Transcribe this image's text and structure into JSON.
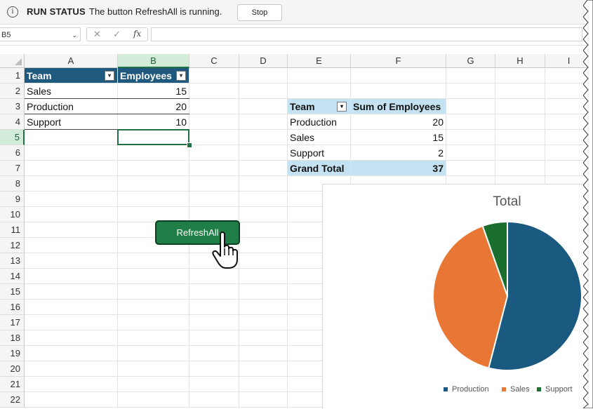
{
  "run_status": {
    "title": "RUN STATUS",
    "message": "The button RefreshAll is running.",
    "stop_label": "Stop",
    "info_glyph": "i"
  },
  "formula_bar": {
    "name_box": "B5",
    "cancel_glyph": "✕",
    "enter_glyph": "✓",
    "fx_glyph": "fx",
    "formula": ""
  },
  "columns": [
    "A",
    "B",
    "C",
    "D",
    "E",
    "F",
    "G",
    "H",
    "I"
  ],
  "selected_column": "B",
  "rows": [
    "1",
    "2",
    "3",
    "4",
    "5",
    "6",
    "7",
    "8",
    "9",
    "10",
    "11",
    "12",
    "13",
    "14",
    "15",
    "16",
    "17",
    "18",
    "19",
    "20",
    "21",
    "22"
  ],
  "selected_row": "5",
  "table": {
    "headers": [
      "Team",
      "Employees"
    ],
    "rows": [
      {
        "team": "Sales",
        "employees": "15"
      },
      {
        "team": "Production",
        "employees": "20"
      },
      {
        "team": "Support",
        "employees": "10"
      }
    ]
  },
  "pivot": {
    "headers": [
      "Team",
      "Sum of Employees"
    ],
    "rows": [
      {
        "team": "Production",
        "sum": "20"
      },
      {
        "team": "Sales",
        "sum": "15"
      },
      {
        "team": "Support",
        "sum": "2"
      }
    ],
    "total_label": "Grand Total",
    "total_value": "37"
  },
  "button": {
    "label": "RefreshAll",
    "color": "#1e7e45"
  },
  "colors": {
    "table_header": "#1f5a7e",
    "pivot_header": "#c4e2f1",
    "selection": "#217346"
  },
  "chart_data": {
    "type": "pie",
    "title": "Total",
    "categories": [
      "Production",
      "Sales",
      "Support"
    ],
    "values": [
      20,
      15,
      2
    ],
    "colors": [
      "#1a5a80",
      "#e87634",
      "#1a6e2e"
    ],
    "legend": "bottom"
  }
}
